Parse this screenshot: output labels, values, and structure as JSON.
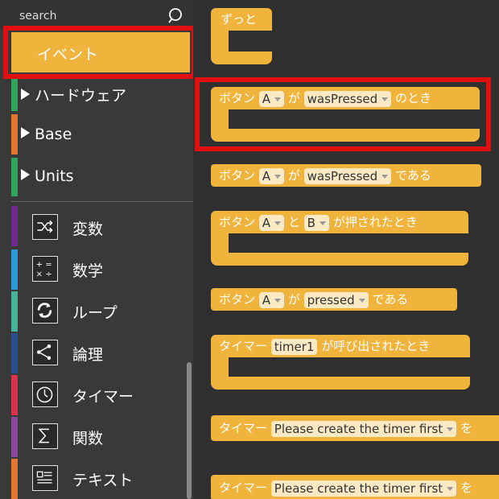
{
  "search": {
    "placeholder": "search"
  },
  "categories": {
    "event": "イベント",
    "hardware": "ハードウェア",
    "base": "Base",
    "units": "Units",
    "variables": "変数",
    "math": "数学",
    "loops": "ループ",
    "logic": "論理",
    "timer": "タイマー",
    "functions": "関数",
    "text": "テキスト"
  },
  "blocks": {
    "forever": "ずっと",
    "b2": {
      "prefix": "ボタン",
      "dd1": "A",
      "mid": "が",
      "dd2": "wasPressed",
      "suffix": "のとき"
    },
    "b3": {
      "prefix": "ボタン",
      "dd1": "A",
      "mid": "が",
      "dd2": "wasPressed",
      "suffix": "である"
    },
    "b4": {
      "prefix": "ボタン",
      "dd1": "A",
      "mid": "と",
      "dd2": "B",
      "suffix": "が押されたとき"
    },
    "b5": {
      "prefix": "ボタン",
      "dd1": "A",
      "mid": "が",
      "dd2": "pressed",
      "suffix": "である"
    },
    "b6": {
      "prefix": "タイマー",
      "dd1": "timer1",
      "suffix": "が呼び出されたとき"
    },
    "b7": {
      "prefix": "タイマー",
      "dd1": "Please create the timer first",
      "suffix": "を"
    },
    "b8": {
      "prefix": "タイマー",
      "dd1": "Please create the timer first",
      "suffix": "を"
    }
  },
  "colors": {
    "event": "#f0b43c",
    "hardware": "#2fa45a",
    "base": "#e0762f",
    "units": "#2fa45a",
    "variables": "#6f2a8e",
    "math": "#2f9bd6",
    "loops": "#47b49a",
    "logic": "#2a4e8e",
    "timer": "#d9334f",
    "functions": "#8a4aa0",
    "text": "#e0762f",
    "highlight": "#e10f0f"
  }
}
